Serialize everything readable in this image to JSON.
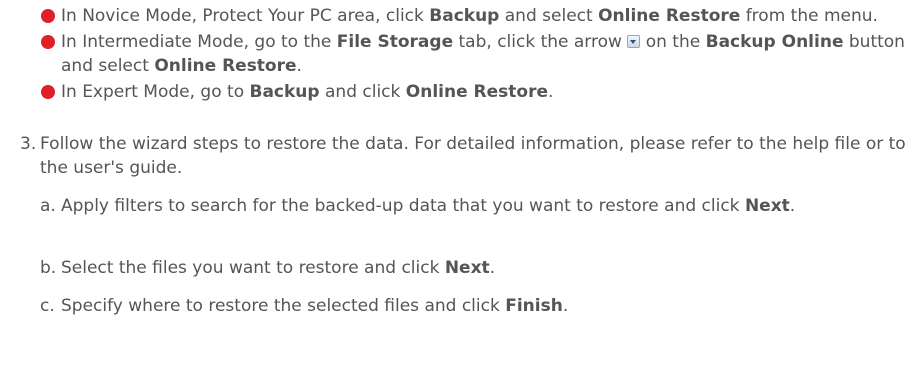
{
  "bullets": [
    {
      "p1": "In Novice Mode, Protect Your PC area, click ",
      "b1": "Backup",
      "p2": " and select ",
      "b2": "Online Restore",
      "p3": " from the menu."
    },
    {
      "p1": "In Intermediate Mode, go to the ",
      "b1": "File Storage",
      "p2": " tab, click the arrow ",
      "p3": " on the ",
      "b2": "Backup Online",
      "p4": " button and select ",
      "b3": "Online Restore",
      "p5": "."
    },
    {
      "p1": "In Expert Mode, go to ",
      "b1": "Backup",
      "p2": " and click ",
      "b2": "Online Restore",
      "p3": "."
    }
  ],
  "step3": {
    "number": "3.",
    "text": "Follow the wizard steps to restore the data. For detailed information, please refer to the help file or to the user's guide."
  },
  "substeps": [
    {
      "letter": "a.",
      "p1": "Apply filters to search for the backed-up data that you want to restore and click ",
      "b1": "Next",
      "p2": "."
    },
    {
      "letter": "b.",
      "p1": "Select the files you want to restore and click ",
      "b1": "Next",
      "p2": "."
    },
    {
      "letter": "c.",
      "p1": "Specify where to restore the selected files and click ",
      "b1": "Finish",
      "p2": "."
    }
  ]
}
